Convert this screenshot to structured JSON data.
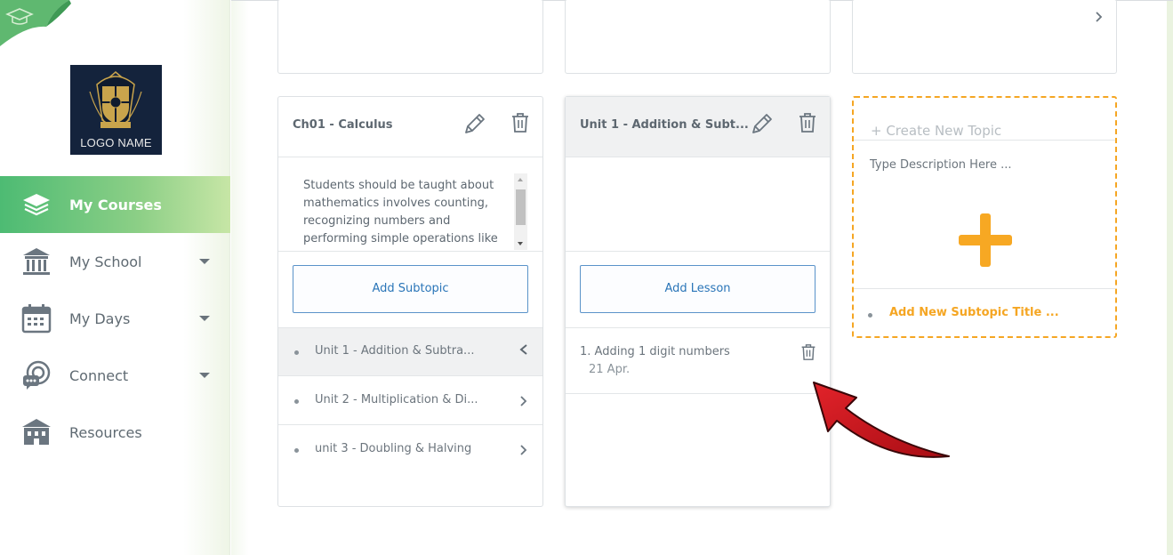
{
  "sidebar": {
    "logo_text": "LOGO NAME",
    "items": [
      {
        "label": "My Courses",
        "icon": "stack-layers-icon",
        "active": true,
        "has_caret": false
      },
      {
        "label": "My School",
        "icon": "school-building-icon",
        "active": false,
        "has_caret": true
      },
      {
        "label": "My Days",
        "icon": "calendar-icon",
        "active": false,
        "has_caret": true
      },
      {
        "label": "Connect",
        "icon": "chat-connect-icon",
        "active": false,
        "has_caret": true
      },
      {
        "label": "Resources",
        "icon": "library-icon",
        "active": false,
        "has_caret": false
      }
    ]
  },
  "chapter_card": {
    "title": "Ch01 - Calculus",
    "description": "Students should be taught about mathematics involves counting, recognizing numbers and performing simple operations like",
    "add_button": "Add Subtopic",
    "subtopics": [
      {
        "label": "Unit 1 - Addition & Subtra...",
        "selected": true
      },
      {
        "label": "Unit 2 - Multiplication & Di...",
        "selected": false
      },
      {
        "label": "unit 3 - Doubling & Halving",
        "selected": false
      }
    ]
  },
  "unit_card": {
    "title": "Unit 1 - Addition & Subt...",
    "add_button": "Add Lesson",
    "lessons": [
      {
        "title": "1. Adding 1 digit numbers",
        "date": "21 Apr."
      }
    ]
  },
  "new_topic_card": {
    "title": "+ Create New Topic",
    "description_placeholder": "Type Description Here ...",
    "add_subtopic": "Add New Subtopic Title ..."
  },
  "colors": {
    "accent_green": "#4dbb73",
    "accent_orange": "#f5a623",
    "button_blue": "#2a75b8",
    "annotation_red": "#d0121b"
  }
}
